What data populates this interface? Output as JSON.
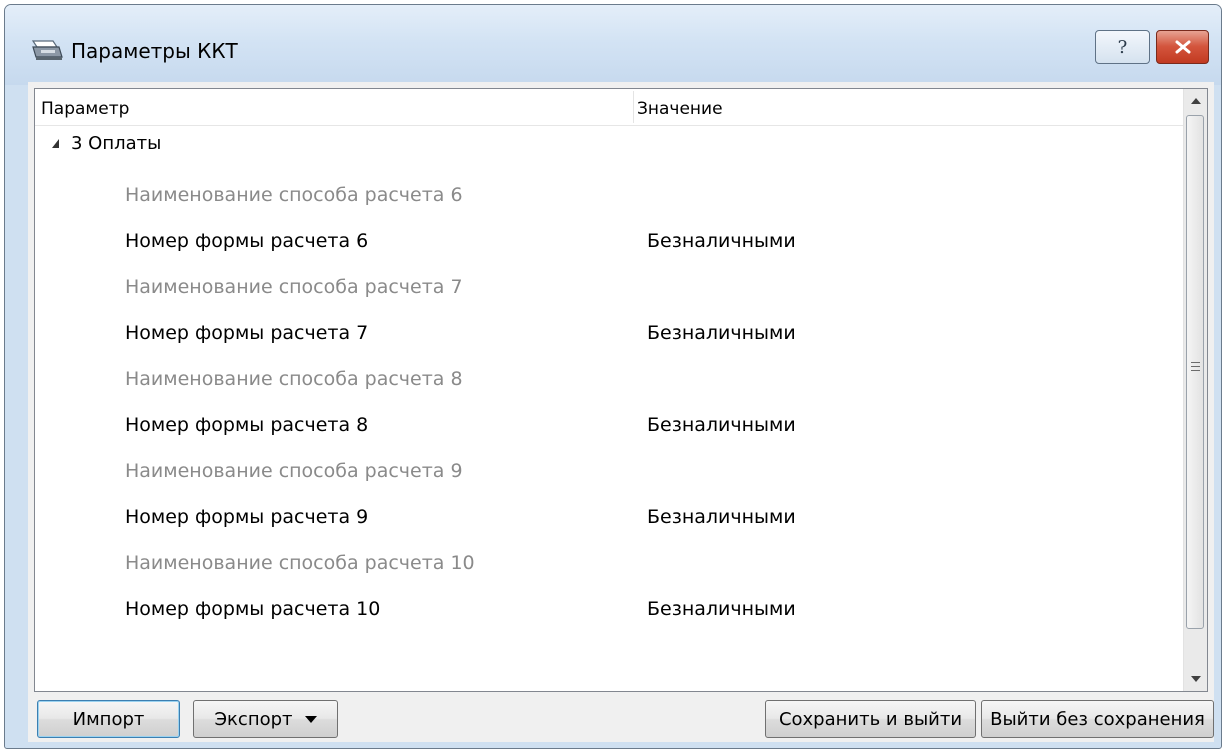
{
  "window": {
    "title": "Параметры ККТ",
    "help_label": "?"
  },
  "grid": {
    "columns": {
      "parameter": "Параметр",
      "value": "Значение"
    },
    "group": {
      "label": "3 Оплаты"
    },
    "rows": [
      {
        "param": "Наименование способа расчета 6",
        "value": ""
      },
      {
        "param": "Номер формы расчета 6",
        "value": "Безналичными"
      },
      {
        "param": "Наименование способа расчета 7",
        "value": ""
      },
      {
        "param": "Номер формы расчета 7",
        "value": "Безналичными"
      },
      {
        "param": "Наименование способа расчета 8",
        "value": ""
      },
      {
        "param": "Номер формы расчета 8",
        "value": "Безналичными"
      },
      {
        "param": "Наименование способа расчета 9",
        "value": ""
      },
      {
        "param": "Номер формы расчета 9",
        "value": "Безналичными"
      },
      {
        "param": "Наименование способа расчета 10",
        "value": ""
      },
      {
        "param": "Номер формы расчета 10",
        "value": "Безналичными"
      }
    ]
  },
  "buttons": {
    "import": "Импорт",
    "export": "Экспорт",
    "save_exit": "Сохранить и выйти",
    "exit_no_save": "Выйти без сохранения"
  },
  "colors": {
    "dim_text": "#8a8a8a",
    "close_red": "#c23a21",
    "chrome_blue": "#cfe0f1"
  },
  "icons": {
    "title": "printer-icon",
    "help": "help-icon",
    "close": "close-icon"
  }
}
